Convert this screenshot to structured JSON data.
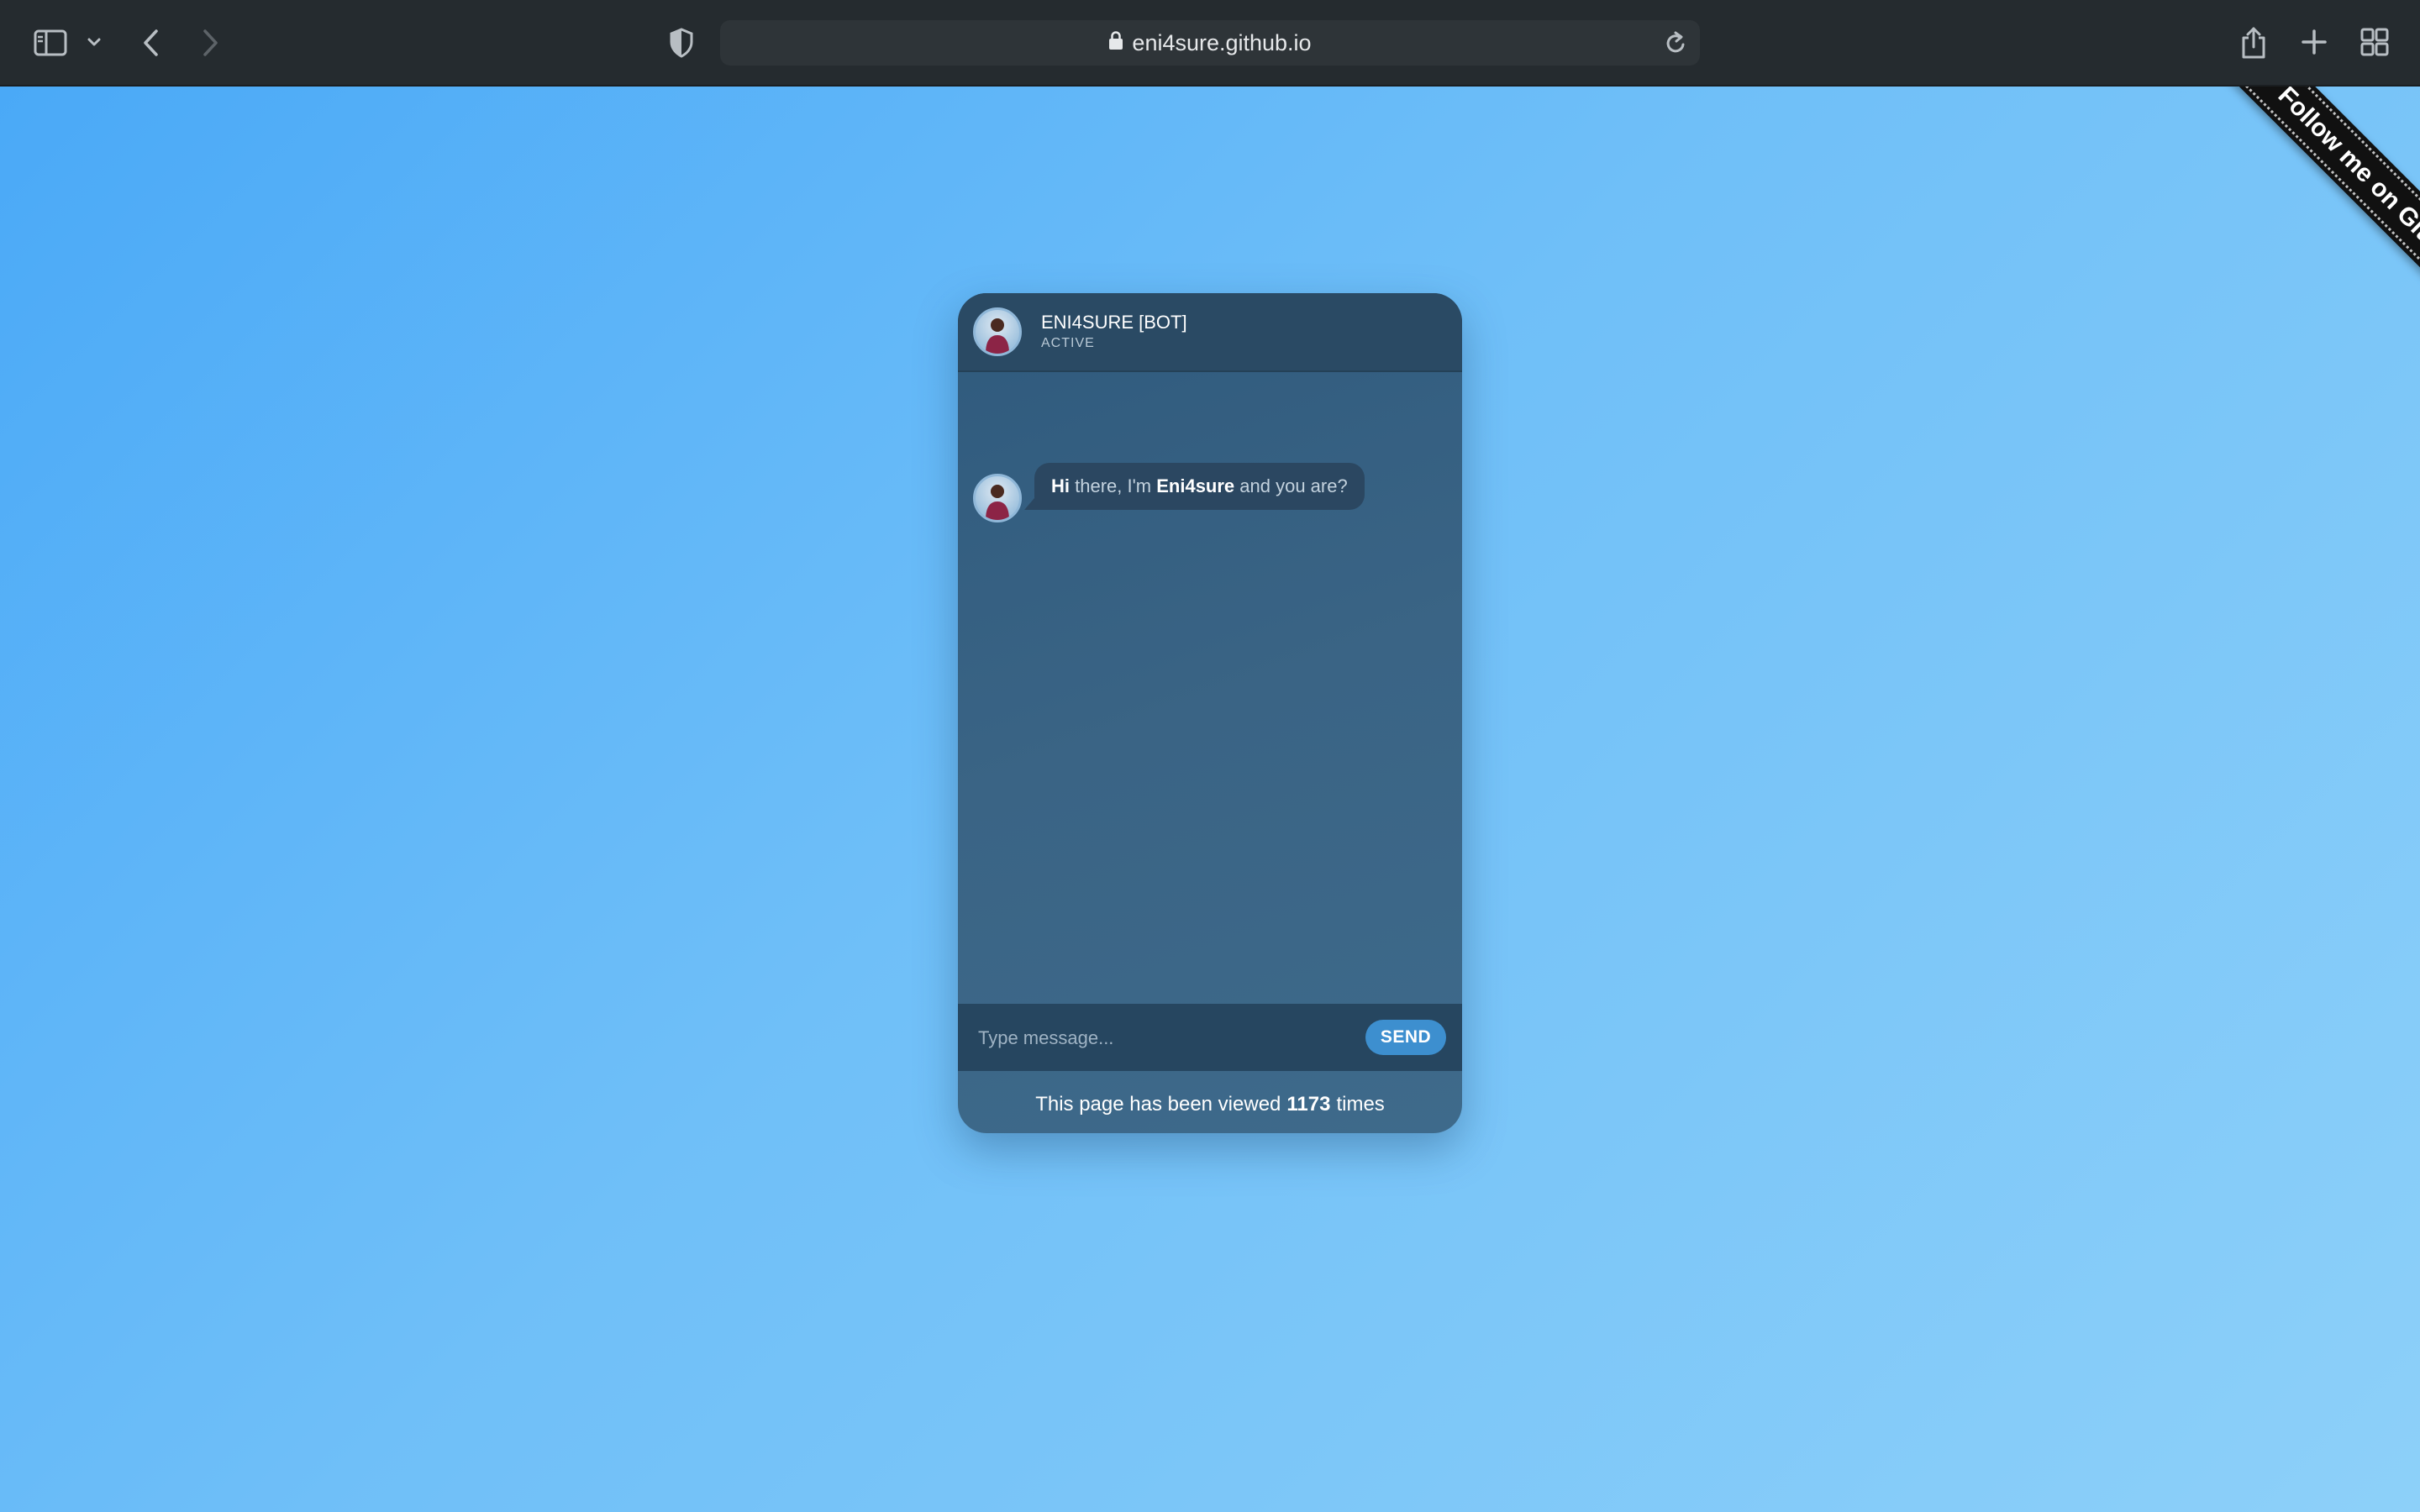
{
  "browser": {
    "url": "eni4sure.github.io",
    "icons": {
      "sidebar": "sidebar-icon",
      "sidebar_menu": "chevron-down-icon",
      "back": "back-arrow-icon",
      "forward": "forward-arrow-icon",
      "privacy": "shield-icon",
      "lock": "lock-icon",
      "reload": "reload-icon",
      "share": "share-icon",
      "new_tab": "plus-icon",
      "tab_overview": "tab-grid-icon"
    }
  },
  "ribbon": {
    "label": "Follow me on GitHub"
  },
  "chat": {
    "bot_name": "ENI4SURE [BOT]",
    "status": "ACTIVE",
    "messages": [
      {
        "sender": "bot",
        "parts": {
          "greeting": "Hi",
          "text1": " there, I'm ",
          "name": "Eni4sure",
          "text2": " and you are?"
        }
      }
    ],
    "input_placeholder": "Type message...",
    "send_label": "SEND"
  },
  "footer": {
    "prefix": "This page has been viewed",
    "count": "1173",
    "suffix": "times"
  },
  "colors": {
    "page_gradient_start": "#4aa9f7",
    "page_gradient_end": "#8dd0f9",
    "chat_body": "#3a6485",
    "chat_header": "#2a4a64",
    "send_button": "#3d8fcf",
    "toolbar": "#252b2f"
  }
}
